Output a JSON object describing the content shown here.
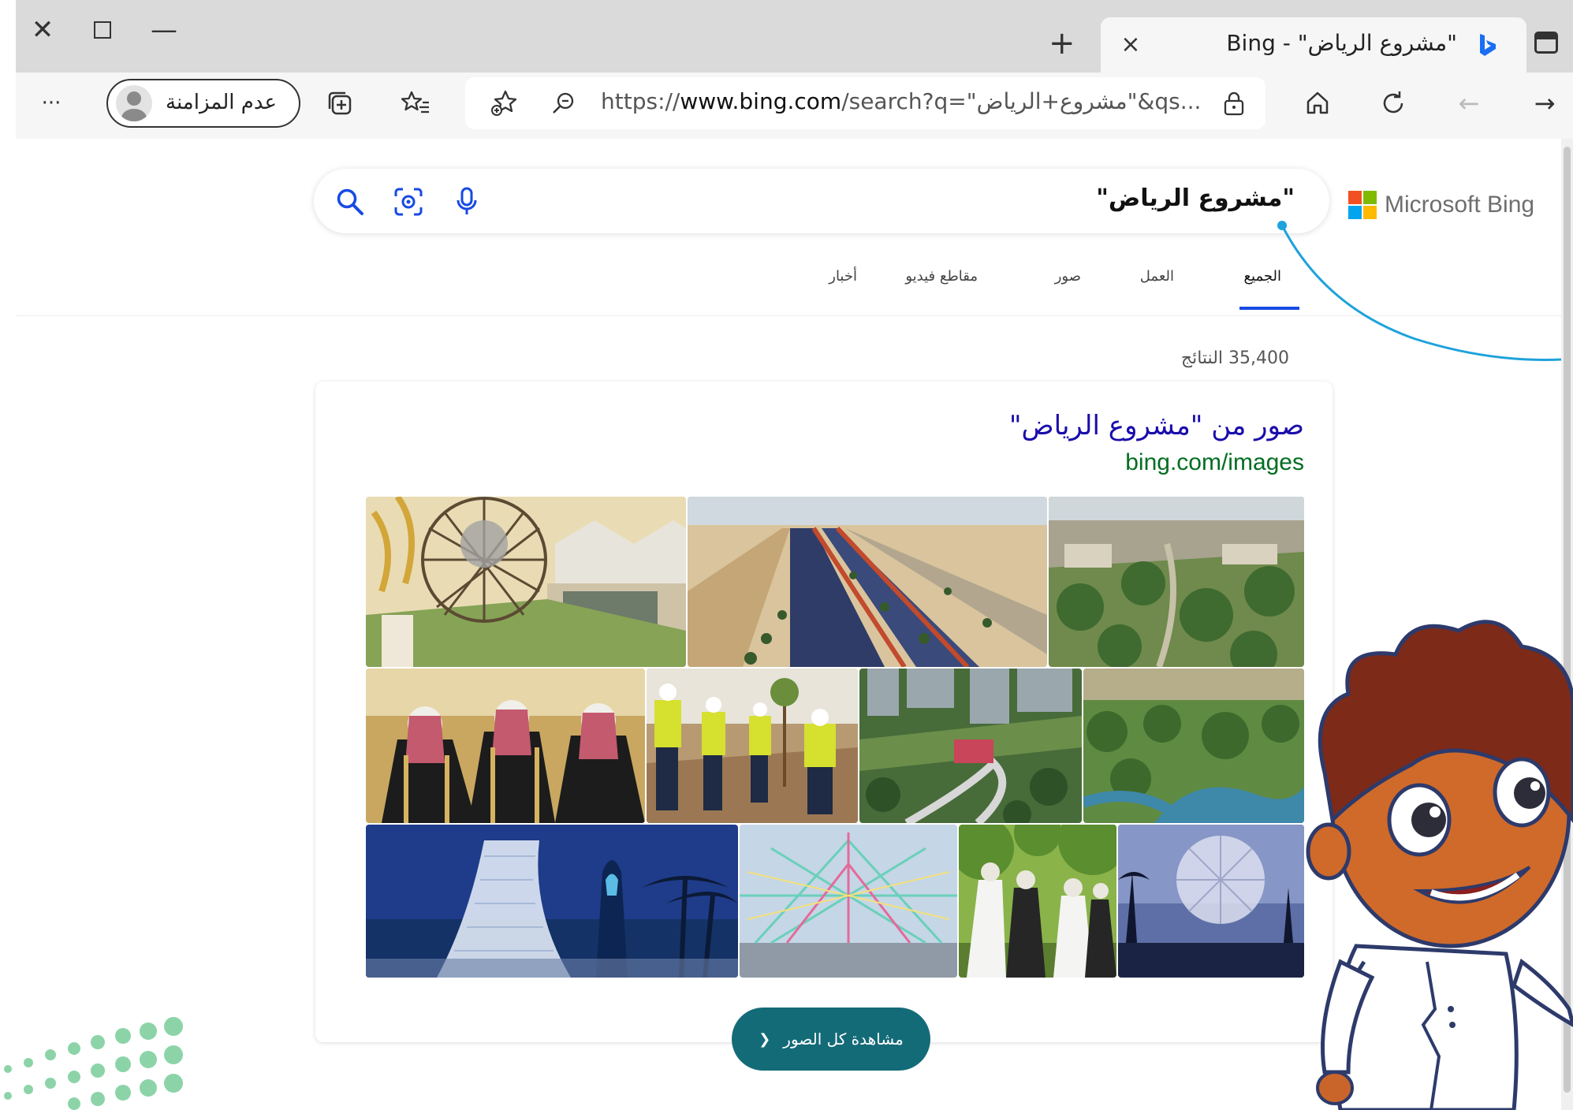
{
  "browser": {
    "tab_title": "\"مشروع الرياض\" - Bing",
    "tab_close": "×",
    "new_tab": "+",
    "profile_label": "عدم المزامنة",
    "more_menu": "···",
    "url_prefix": "https://",
    "url_domain": "www.bing.com",
    "url_rest": "/search?q=\"مشروع+الرياض\"&qs..."
  },
  "page": {
    "brand": "Microsoft Bing",
    "search_query": "\"مشروع الرياض\"",
    "tabs": [
      "الجميع",
      "العمل",
      "صور",
      "مقاطع فيديو",
      "أخبار"
    ],
    "active_tab_index": 0,
    "results_count": "35,400 النتائج",
    "card": {
      "title": "صور من \"مشروع الرياض\"",
      "url": "bing.com/images"
    },
    "see_all_label": "مشاهدة كل الصور",
    "see_all_chevron": "❮"
  },
  "colors": {
    "accent": "#174ae4",
    "button": "#146b78",
    "link": "#1a0dab",
    "url_green": "#006d21",
    "callout_line": "#1ea2dc",
    "decor_green": "#8cd4a8"
  }
}
